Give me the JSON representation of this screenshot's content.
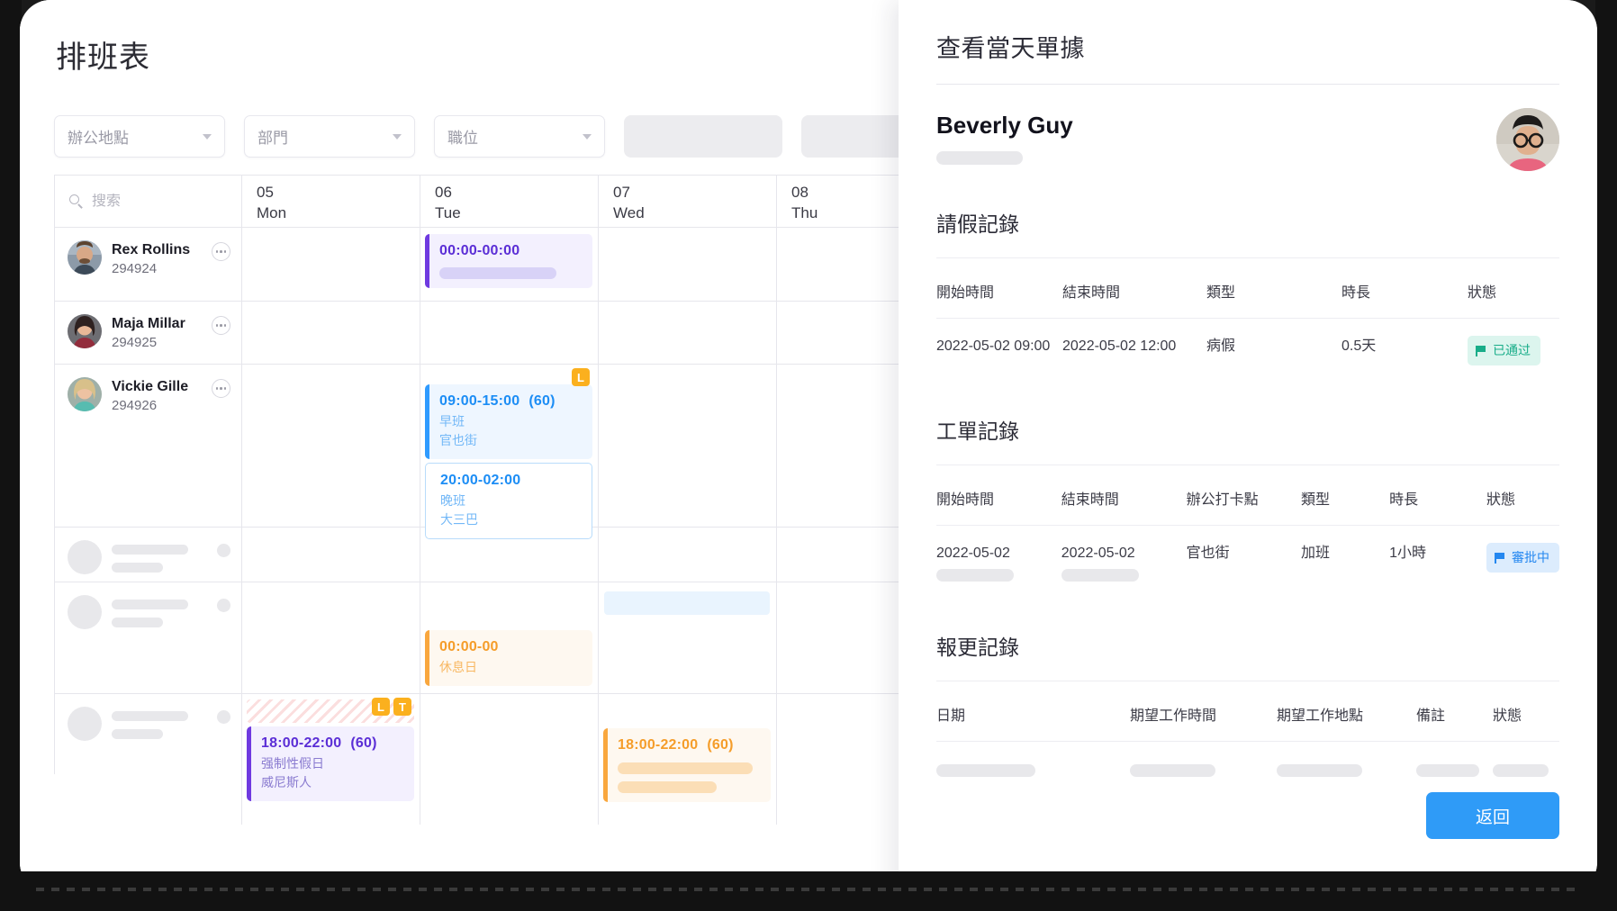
{
  "schedule": {
    "title": "排班表",
    "filters": [
      {
        "label": "辦公地點",
        "type": "select"
      },
      {
        "label": "部門",
        "type": "select"
      },
      {
        "label": "職位",
        "type": "select"
      }
    ],
    "search": {
      "placeholder": "搜索",
      "value": ""
    },
    "days": [
      {
        "num": "05",
        "name": "Mon"
      },
      {
        "num": "06",
        "name": "Tue"
      },
      {
        "num": "07",
        "name": "Wed"
      },
      {
        "num": "08",
        "name": "Thu"
      }
    ],
    "employees": [
      {
        "name": "Rex Rollins",
        "id": "294924",
        "skeleton": false
      },
      {
        "name": "Maja Millar",
        "id": "294925",
        "skeleton": false
      },
      {
        "name": "Vickie Gille",
        "id": "294926",
        "skeleton": false
      },
      {
        "name": "",
        "id": "",
        "skeleton": true
      },
      {
        "name": "",
        "id": "",
        "skeleton": true
      },
      {
        "name": "",
        "id": "",
        "skeleton": true
      }
    ],
    "shifts": {
      "rex_tue": {
        "time": "00:00-00:00",
        "minutes": "",
        "shift_name": "",
        "location": ""
      },
      "vickie_tue_day": {
        "time": "09:00-15:00",
        "minutes": "(60)",
        "shift_name": "早班",
        "location": "官也街",
        "badge": "L"
      },
      "vickie_tue_night": {
        "time": "20:00-02:00",
        "minutes": "",
        "shift_name": "晚班",
        "location": "大三巴"
      },
      "row5_tue_rest": {
        "time": "00:00-00",
        "minutes": "",
        "shift_name": "休息日",
        "location": ""
      },
      "row6_mon": {
        "time": "18:00-22:00",
        "minutes": "(60)",
        "shift_name": "强制性假日",
        "location": "威尼斯人",
        "badges": [
          "L",
          "T"
        ]
      },
      "row6_wed": {
        "time": "18:00-22:00",
        "minutes": "(60)",
        "shift_name": "",
        "location": ""
      }
    }
  },
  "panel": {
    "title": "查看當天單據",
    "person": {
      "name": "Beverly Guy"
    },
    "leave_section": {
      "title": "請假記錄",
      "headers": [
        "開始時間",
        "結束時間",
        "類型",
        "時長",
        "狀態"
      ],
      "rows": [
        {
          "start": "2022-05-02 09:00",
          "end": "2022-05-02 12:00",
          "type": "病假",
          "duration": "0.5天",
          "status": "已通过",
          "status_color": "green"
        }
      ]
    },
    "workorder_section": {
      "title": "工單記錄",
      "headers": [
        "開始時間",
        "結束時間",
        "辦公打卡點",
        "類型",
        "時長",
        "狀態"
      ],
      "rows": [
        {
          "start": "2022-05-02",
          "end": "2022-05-02",
          "checkpoint": "官也街",
          "type": "加班",
          "duration": "1小時",
          "status": "審批中",
          "status_color": "blue"
        }
      ]
    },
    "shiftchange_section": {
      "title": "報更記錄",
      "headers": [
        "日期",
        "期望工作時間",
        "期望工作地點",
        "備註",
        "狀態"
      ],
      "rows": [
        {
          "date": "",
          "expected_time": "",
          "expected_location": "",
          "remark": "",
          "status": ""
        }
      ]
    },
    "back_button": "返回"
  },
  "colors": {
    "accent_blue": "#2f9bf7",
    "purple": "#6f3ae0",
    "orange": "#f9a73e",
    "badge_yellow": "#fbb01e",
    "status_green": "#18ad89"
  }
}
